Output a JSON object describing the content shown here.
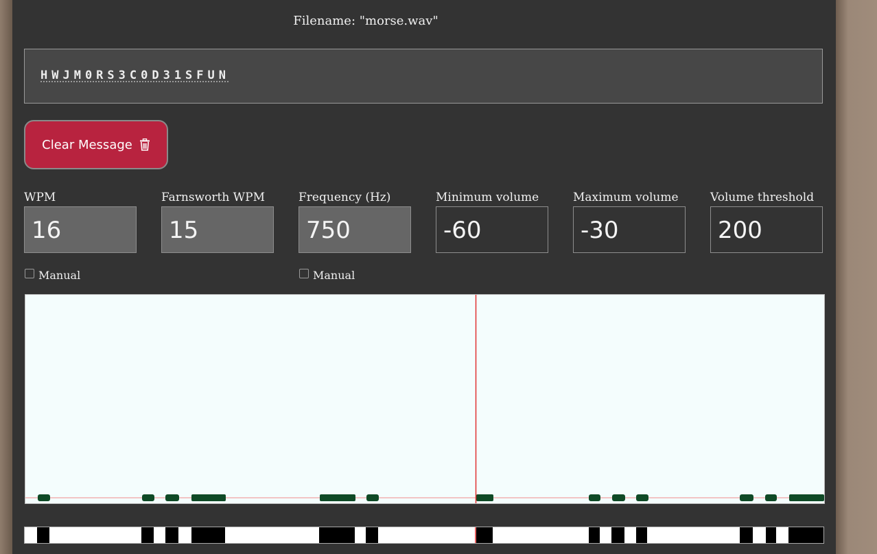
{
  "filename": "Filename: \"morse.wav\"",
  "message": "HWJM0RS3C0D31SFUN",
  "clear_button": {
    "label": "Clear Message",
    "icon": "trash-icon"
  },
  "fields": [
    {
      "label": "WPM",
      "value": "16",
      "disabled": true
    },
    {
      "label": "Farnsworth WPM",
      "value": "15",
      "disabled": true
    },
    {
      "label": "Frequency (Hz)",
      "value": "750",
      "disabled": true
    },
    {
      "label": "Minimum volume",
      "value": "-60",
      "disabled": false
    },
    {
      "label": "Maximum volume",
      "value": "-30",
      "disabled": false
    },
    {
      "label": "Volume threshold",
      "value": "200",
      "disabled": false
    }
  ],
  "manual_wpm": {
    "label": "Manual",
    "checked": false
  },
  "manual_freq": {
    "label": "Manual",
    "checked": false
  },
  "colors": {
    "panel": "#333333",
    "button": "#b8233f",
    "signal": "#0f4a26",
    "playhead": "#e03030",
    "scope_bg": "#f4fdfd"
  }
}
